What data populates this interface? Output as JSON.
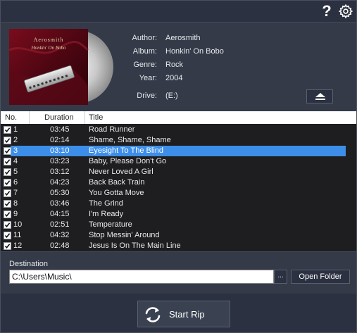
{
  "toolbar": {
    "help_label": "?",
    "help_icon": "question-mark-icon",
    "settings_icon": "gear-icon"
  },
  "album": {
    "cover_artist_text": "Aerosmith",
    "cover_album_text": "Honkin' On Bobo",
    "fields": [
      {
        "label": "Author:",
        "value": "Aerosmith"
      },
      {
        "label": "Album:",
        "value": "Honkin' On Bobo"
      },
      {
        "label": "Genre:",
        "value": "Rock"
      },
      {
        "label": "Year:",
        "value": "2004"
      }
    ],
    "drive_label": "Drive:",
    "drive_value": "(E:)",
    "eject_icon": "eject-icon"
  },
  "table": {
    "columns": [
      "No.",
      "Duration",
      "Title"
    ],
    "selected_index": 2,
    "tracks": [
      {
        "no": "1",
        "duration": "03:45",
        "title": "Road Runner",
        "checked": true
      },
      {
        "no": "2",
        "duration": "02:14",
        "title": "Shame, Shame, Shame",
        "checked": true
      },
      {
        "no": "3",
        "duration": "03:10",
        "title": "Eyesight To The Blind",
        "checked": true
      },
      {
        "no": "4",
        "duration": "03:23",
        "title": "Baby, Please Don't Go",
        "checked": true
      },
      {
        "no": "5",
        "duration": "03:12",
        "title": "Never Loved A Girl",
        "checked": true
      },
      {
        "no": "6",
        "duration": "04:23",
        "title": "Back Back Train",
        "checked": true
      },
      {
        "no": "7",
        "duration": "05:30",
        "title": "You Gotta Move",
        "checked": true
      },
      {
        "no": "8",
        "duration": "03:46",
        "title": "The Grind",
        "checked": true
      },
      {
        "no": "9",
        "duration": "04:15",
        "title": "I'm Ready",
        "checked": true
      },
      {
        "no": "10",
        "duration": "02:51",
        "title": "Temperature",
        "checked": true
      },
      {
        "no": "11",
        "duration": "04:32",
        "title": "Stop Messin' Around",
        "checked": true
      },
      {
        "no": "12",
        "duration": "02:48",
        "title": "Jesus Is On The Main Line",
        "checked": true
      }
    ]
  },
  "destination": {
    "label": "Destination",
    "value": "C:\\Users\\Music\\",
    "browse_label": "...",
    "open_folder_label": "Open Folder"
  },
  "actions": {
    "start_rip_label": "Start Rip",
    "start_rip_icon": "refresh-icon"
  },
  "colors": {
    "background": "#2b3140",
    "panel": "#343a48",
    "selection": "#3d8ee8",
    "table_bg": "#1e1e20"
  }
}
